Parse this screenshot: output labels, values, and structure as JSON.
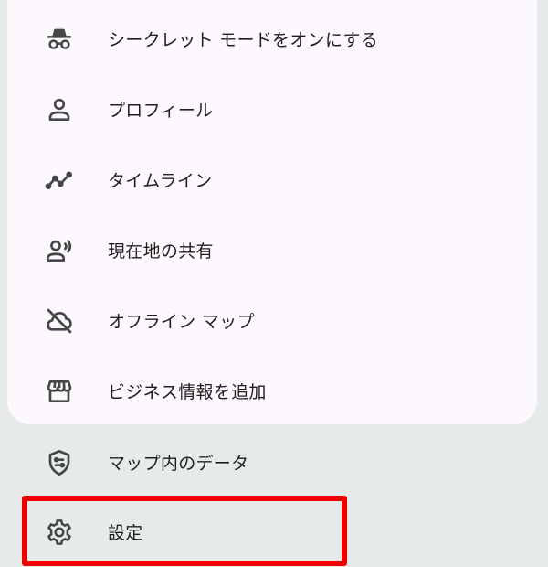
{
  "menu": {
    "incognito": "シークレット モードをオンにする",
    "profile": "プロフィール",
    "timeline": "タイムライン",
    "location_sharing": "現在地の共有",
    "offline_maps": "オフライン マップ",
    "add_business": "ビジネス情報を追加",
    "your_data": "マップ内のデータ",
    "settings": "設定"
  },
  "colors": {
    "panel": "#fdf8fd",
    "background": "#e6ebe9",
    "highlight": "#f20000",
    "icon": "#444746"
  }
}
